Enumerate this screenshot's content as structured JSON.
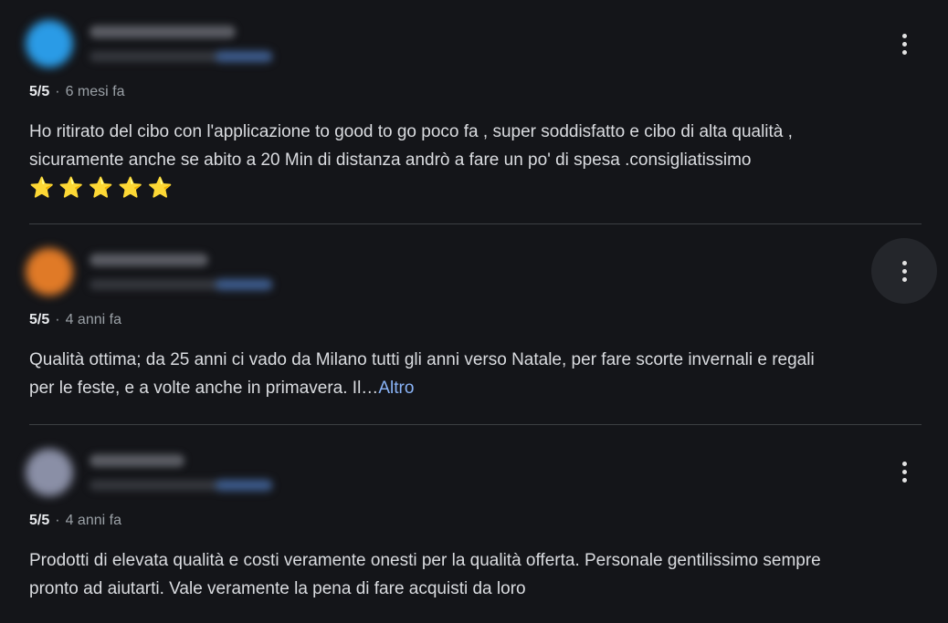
{
  "reviews": [
    {
      "rating": "5/5",
      "time": "6 mesi fa",
      "text_line1": "Ho ritirato del cibo con l'applicazione to good to go poco fa , super soddisfatto e cibo di alta qualità ,",
      "text_line2": "sicuramente anche se abito a 20 Min di distanza andrò a fare un po' di spesa .consigliatissimo",
      "emoji": [
        "⭐",
        "⭐",
        "⭐",
        "⭐",
        "⭐"
      ]
    },
    {
      "rating": "5/5",
      "time": "4 anni fa",
      "text_line1": "Qualità ottima; da 25 anni ci vado da Milano tutti gli anni verso Natale, per fare scorte invernali e regali",
      "text_line2": "per le feste, e a volte anche in primavera. Il…",
      "more_label": "Altro"
    },
    {
      "rating": "5/5",
      "time": "4 anni fa",
      "text_line1": "Prodotti di elevata qualità e costi veramente onesti per la qualità offerta. Personale gentilissimo sempre",
      "text_line2": "pronto ad aiutarti. Vale veramente la pena di fare acquisti da loro"
    }
  ],
  "meta_separator": "·",
  "icons": {
    "menu": "more-vert-icon",
    "star": "star-emoji-icon"
  },
  "colors": {
    "background": "#141519",
    "link": "#8ab4f8",
    "star": "#f7c53a"
  }
}
